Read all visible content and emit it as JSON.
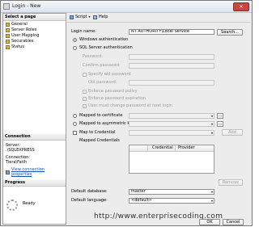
{
  "window": {
    "title": "Login - New",
    "close_glyph": "✕"
  },
  "left_pane": {
    "select_page_header": "Select a page",
    "pages": [
      {
        "label": "General"
      },
      {
        "label": "Server Roles"
      },
      {
        "label": "User Mapping"
      },
      {
        "label": "Securables"
      },
      {
        "label": "Status"
      }
    ],
    "connection_header": "Connection",
    "server_label": "Server:",
    "server_value": ".\\SQLEXPRESS",
    "connection_label": "Connection:",
    "connection_value": "Tiera\\Fatih",
    "view_properties_link": "View connection properties",
    "progress_header": "Progress",
    "progress_status": "Ready"
  },
  "toolbar": {
    "script_label": "Script",
    "help_label": "Help"
  },
  "form": {
    "login_name_label": "Login name:",
    "login_name_value": "NT AUTHORITY\\Local Service",
    "search_button": "Search...",
    "windows_auth_label": "Windows authentication",
    "sql_auth_label": "SQL Server authentication",
    "password_label": "Password:",
    "confirm_password_label": "Confirm password:",
    "specify_old_password_label": "Specify old password",
    "old_password_label": "Old password:",
    "enforce_policy_label": "Enforce password policy",
    "enforce_expiration_label": "Enforce password expiration",
    "must_change_label": "User must change password at next login",
    "mapped_cert_label": "Mapped to certificate",
    "mapped_asym_label": "Mapped to asymmetric key",
    "map_credential_label": "Map to Credential",
    "add_button": "Add",
    "mapped_credentials_label": "Mapped Credentials",
    "credential_col": "Credential",
    "provider_col": "Provider",
    "remove_button": "Remove",
    "default_db_label": "Default database:",
    "default_db_value": "master",
    "default_lang_label": "Default language:",
    "default_lang_value": "<default>",
    "ellipsis": "...",
    "combo_arrow": "▾",
    "checkmark": "✓"
  },
  "footer": {
    "ok_button": "OK",
    "cancel_button": "Cancel"
  },
  "watermark": "http://www.enterprisecoding.com"
}
